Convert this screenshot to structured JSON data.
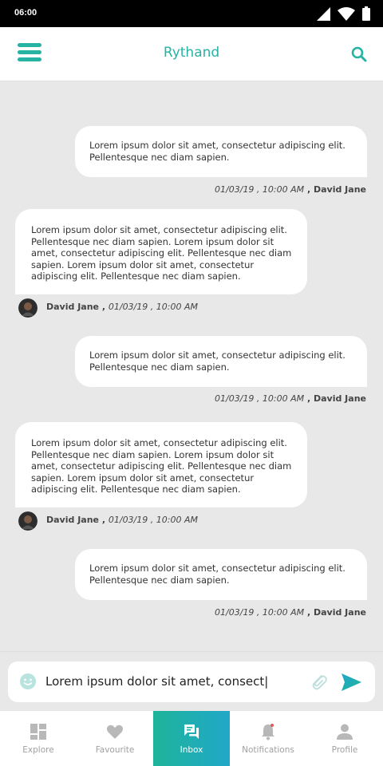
{
  "status_bar": {
    "time": "06:00"
  },
  "app_bar": {
    "title": "Rythand"
  },
  "messages": [
    {
      "direction": "out",
      "text": "Lorem ipsum dolor sit amet, consectetur adipiscing elit. Pellentesque nec diam sapien.",
      "time": "01/03/19 , 10:00 AM",
      "sender": "David Jane"
    },
    {
      "direction": "in",
      "text": "Lorem ipsum dolor sit amet, consectetur adipiscing elit. Pellentesque nec diam sapien. Lorem ipsum dolor sit amet, consectetur adipiscing elit. Pellentesque nec diam sapien. Lorem ipsum dolor sit amet, consectetur adipiscing elit. Pellentesque nec diam sapien.",
      "time": "01/03/19 , 10:00 AM",
      "sender": "David Jane"
    },
    {
      "direction": "out",
      "text": "Lorem ipsum dolor sit amet, consectetur adipiscing elit. Pellentesque nec diam sapien.",
      "time": "01/03/19 , 10:00 AM",
      "sender": "David Jane"
    },
    {
      "direction": "in",
      "text": "Lorem ipsum dolor sit amet, consectetur adipiscing elit. Pellentesque nec diam sapien. Lorem ipsum dolor sit amet, consectetur adipiscing elit. Pellentesque nec diam sapien. Lorem ipsum dolor sit amet, consectetur adipiscing elit. Pellentesque nec diam sapien.",
      "time": "01/03/19 , 10:00 AM",
      "sender": "David Jane"
    },
    {
      "direction": "out",
      "text": "Lorem ipsum dolor sit amet, consectetur adipiscing elit. Pellentesque nec diam sapien.",
      "time": "01/03/19 , 10:00 AM",
      "sender": "David Jane"
    }
  ],
  "composer": {
    "value": "Lorem ipsum dolor sit amet, consect|"
  },
  "nav": {
    "items": [
      {
        "label": "Explore",
        "icon": "explore-icon"
      },
      {
        "label": "Favourite",
        "icon": "heart-icon"
      },
      {
        "label": "Inbox",
        "icon": "inbox-icon",
        "active": true
      },
      {
        "label": "Notifications",
        "icon": "bell-icon"
      },
      {
        "label": "Profile",
        "icon": "profile-icon"
      }
    ]
  },
  "colors": {
    "accent": "#26b3a4",
    "active_gradient_start": "#1fb49a",
    "active_gradient_end": "#20a7c9"
  }
}
